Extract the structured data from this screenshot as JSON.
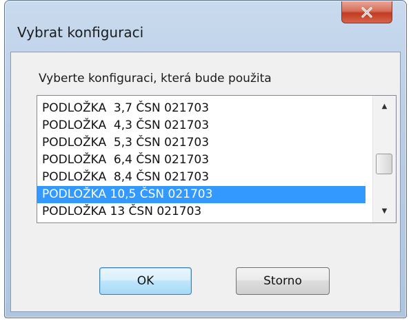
{
  "window": {
    "title": "Vybrat konfiguraci",
    "close_glyph": "X"
  },
  "dialog": {
    "prompt": "Vyberte konfiguraci, která bude použita",
    "list": {
      "items": [
        {
          "label": "PODLOŽKA  3,7 ČSN 021703",
          "selected": false
        },
        {
          "label": "PODLOŽKA  4,3 ČSN 021703",
          "selected": false
        },
        {
          "label": "PODLOŽKA  5,3 ČSN 021703",
          "selected": false
        },
        {
          "label": "PODLOŽKA  6,4 ČSN 021703",
          "selected": false
        },
        {
          "label": "PODLOŽKA  8,4 ČSN 021703",
          "selected": false
        },
        {
          "label": "PODLOŽKA 10,5 ČSN 021703",
          "selected": true
        },
        {
          "label": "PODLOŽKA 13 ČSN 021703",
          "selected": false
        }
      ],
      "scroll_up_icon": "▲",
      "scroll_down_icon": "▼"
    },
    "buttons": {
      "ok_label": "OK",
      "cancel_label": "Storno"
    }
  },
  "colors": {
    "selection": "#3399ff",
    "close_button": "#c13b22"
  }
}
